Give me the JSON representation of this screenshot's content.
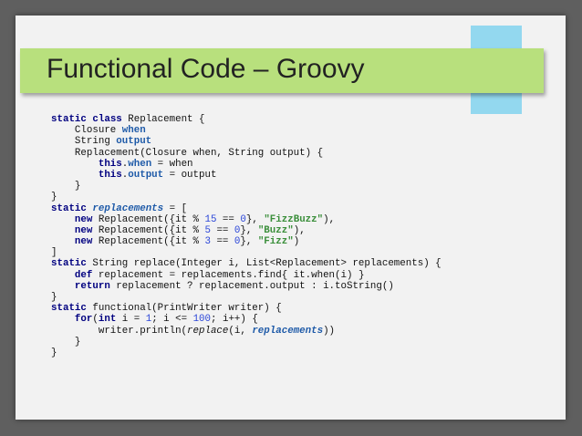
{
  "slide": {
    "title": "Functional Code – Groovy",
    "colors": {
      "background": "#5f5f5f",
      "slide": "#f2f2f2",
      "title_bar": "#b8e07d",
      "accent_block": "#93d8ef",
      "keyword": "#000080",
      "field": "#1e5aa8",
      "number": "#2a45d8",
      "string": "#3b8f3b"
    }
  },
  "code": {
    "lines": [
      [
        [
          "kw",
          "static"
        ],
        [
          "pl",
          " "
        ],
        [
          "kw",
          "class"
        ],
        [
          "pl",
          " Replacement {"
        ]
      ],
      [
        [
          "pl",
          "    Closure "
        ],
        [
          "fld",
          "when"
        ]
      ],
      [
        [
          "pl",
          "    String "
        ],
        [
          "fld",
          "output"
        ]
      ],
      [
        [
          "pl",
          "    Replacement(Closure when, String output) {"
        ]
      ],
      [
        [
          "pl",
          "        "
        ],
        [
          "kw",
          "this"
        ],
        [
          "pl",
          "."
        ],
        [
          "fld",
          "when"
        ],
        [
          "pl",
          " = when"
        ]
      ],
      [
        [
          "pl",
          "        "
        ],
        [
          "kw",
          "this"
        ],
        [
          "pl",
          "."
        ],
        [
          "fld",
          "output"
        ],
        [
          "pl",
          " = output"
        ]
      ],
      [
        [
          "pl",
          "    }"
        ]
      ],
      [
        [
          "pl",
          "}"
        ]
      ],
      [
        [
          "kw",
          "static"
        ],
        [
          "pl",
          " "
        ],
        [
          "fldi",
          "replacements"
        ],
        [
          "pl",
          " = ["
        ]
      ],
      [
        [
          "pl",
          "    "
        ],
        [
          "kw",
          "new"
        ],
        [
          "pl",
          " Replacement({it % "
        ],
        [
          "num",
          "15"
        ],
        [
          "pl",
          " == "
        ],
        [
          "num",
          "0"
        ],
        [
          "pl",
          "}, "
        ],
        [
          "str",
          "\"FizzBuzz\""
        ],
        [
          "pl",
          "),"
        ]
      ],
      [
        [
          "pl",
          "    "
        ],
        [
          "kw",
          "new"
        ],
        [
          "pl",
          " Replacement({it % "
        ],
        [
          "num",
          "5"
        ],
        [
          "pl",
          " == "
        ],
        [
          "num",
          "0"
        ],
        [
          "pl",
          "}, "
        ],
        [
          "str",
          "\"Buzz\""
        ],
        [
          "pl",
          "),"
        ]
      ],
      [
        [
          "pl",
          "    "
        ],
        [
          "kw",
          "new"
        ],
        [
          "pl",
          " Replacement({it % "
        ],
        [
          "num",
          "3"
        ],
        [
          "pl",
          " == "
        ],
        [
          "num",
          "0"
        ],
        [
          "pl",
          "}, "
        ],
        [
          "str",
          "\"Fizz\""
        ],
        [
          "pl",
          ")"
        ]
      ],
      [
        [
          "pl",
          "]"
        ]
      ],
      [
        [
          "kw",
          "static"
        ],
        [
          "pl",
          " String replace(Integer i, List<Replacement> replacements) {"
        ]
      ],
      [
        [
          "pl",
          "    "
        ],
        [
          "kw",
          "def"
        ],
        [
          "pl",
          " replacement = replacements.find{ it.when(i) }"
        ]
      ],
      [
        [
          "pl",
          "    "
        ],
        [
          "kw",
          "return"
        ],
        [
          "pl",
          " replacement ? replacement.output : i.toString()"
        ]
      ],
      [
        [
          "pl",
          "}"
        ]
      ],
      [
        [
          "kw",
          "static"
        ],
        [
          "pl",
          " functional(PrintWriter writer) {"
        ]
      ],
      [
        [
          "pl",
          "    "
        ],
        [
          "kw",
          "for"
        ],
        [
          "pl",
          "("
        ],
        [
          "kw",
          "int"
        ],
        [
          "pl",
          " i = "
        ],
        [
          "num",
          "1"
        ],
        [
          "pl",
          "; i <= "
        ],
        [
          "num",
          "100"
        ],
        [
          "pl",
          "; i++) {"
        ]
      ],
      [
        [
          "pl",
          "        writer.println("
        ],
        [
          "it",
          "replace"
        ],
        [
          "pl",
          "(i, "
        ],
        [
          "fldi",
          "replacements"
        ],
        [
          "pl",
          "))"
        ]
      ],
      [
        [
          "pl",
          "    }"
        ]
      ],
      [
        [
          "pl",
          "}"
        ]
      ]
    ]
  }
}
